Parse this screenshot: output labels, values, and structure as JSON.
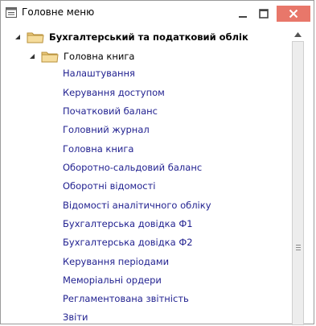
{
  "window": {
    "title": "Головне меню",
    "icons": {
      "window": "menu-window-icon",
      "minimize": "minimize-icon",
      "maximize": "maximize-icon",
      "close": "close-icon"
    },
    "colors": {
      "close_button": "#e8776a",
      "link_text": "#1f1f8f",
      "folder": "#e9c77a"
    }
  },
  "tree": {
    "root": {
      "label": "Бухгалтерський та податковий облік",
      "expanded": true,
      "icon": "folder-icon",
      "group": {
        "label": "Головна книга",
        "expanded": true,
        "icon": "folder-icon",
        "items": [
          "Налаштування",
          "Керування доступом",
          "Початковий баланс",
          "Головний журнал",
          "Головна книга",
          "Оборотно-сальдовий баланс",
          "Оборотні відомості",
          "Відомості аналітичного обліку",
          "Бухгалтерська довідка Ф1",
          "Бухгалтерська довідка Ф2",
          "Керування періодами",
          "Меморіальні ордери",
          "Регламентована звітність",
          "Звіти"
        ]
      }
    }
  },
  "scrollbar": {
    "up_icon": "scroll-up-arrow-icon",
    "grip_icon": "scroll-grip-icon"
  }
}
